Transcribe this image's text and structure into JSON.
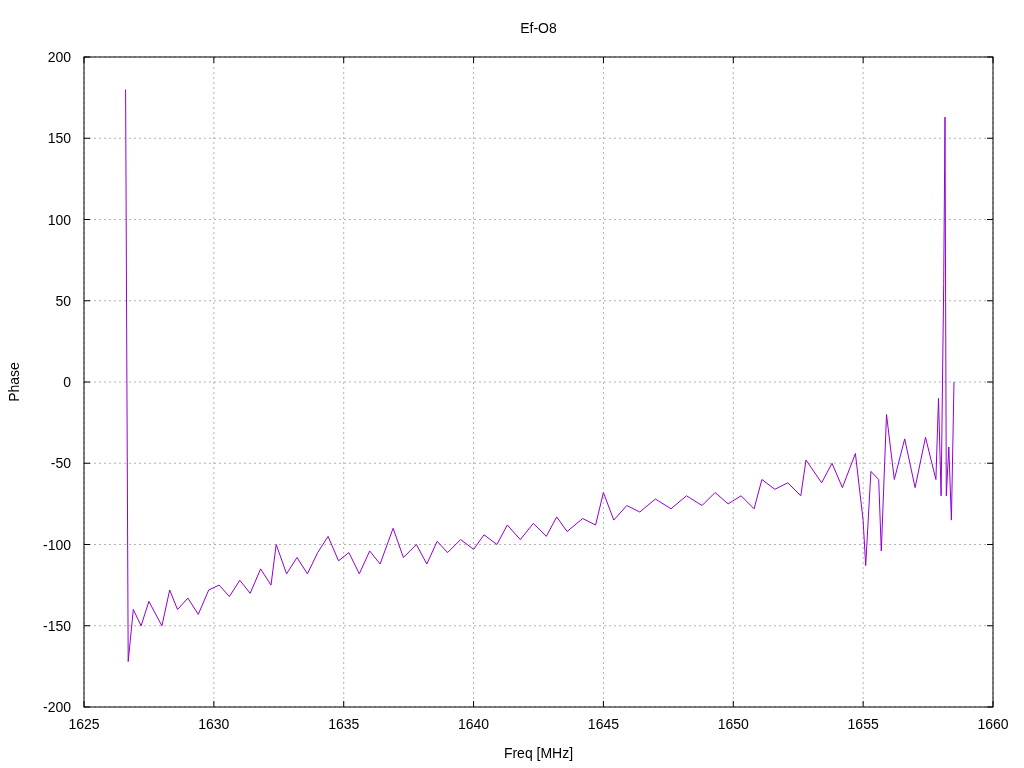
{
  "chart_data": {
    "type": "line",
    "title": "Ef-O8",
    "xlabel": "Freq [MHz]",
    "ylabel": "Phase",
    "xlim": [
      1625,
      1660
    ],
    "ylim": [
      -200,
      200
    ],
    "xticks": [
      1625,
      1630,
      1635,
      1640,
      1645,
      1650,
      1655,
      1660
    ],
    "yticks": [
      -200,
      -150,
      -100,
      -50,
      0,
      50,
      100,
      150,
      200
    ],
    "x": [
      1626.6,
      1626.65,
      1626.7,
      1626.9,
      1627.2,
      1627.5,
      1628.0,
      1628.3,
      1628.6,
      1629.0,
      1629.4,
      1629.8,
      1630.2,
      1630.6,
      1631.0,
      1631.4,
      1631.8,
      1632.2,
      1632.4,
      1632.8,
      1633.2,
      1633.6,
      1634.0,
      1634.4,
      1634.8,
      1635.2,
      1635.6,
      1636.0,
      1636.4,
      1636.9,
      1637.3,
      1637.8,
      1638.2,
      1638.6,
      1639.0,
      1639.5,
      1640.0,
      1640.4,
      1640.9,
      1641.3,
      1641.8,
      1642.3,
      1642.8,
      1643.2,
      1643.6,
      1644.2,
      1644.7,
      1645.0,
      1645.4,
      1645.9,
      1646.4,
      1647.0,
      1647.6,
      1648.2,
      1648.8,
      1649.3,
      1649.8,
      1650.3,
      1650.8,
      1651.1,
      1651.6,
      1652.1,
      1652.6,
      1652.8,
      1653.4,
      1653.8,
      1654.2,
      1654.7,
      1655.0,
      1655.1,
      1655.3,
      1655.6,
      1655.7,
      1655.9,
      1656.2,
      1656.6,
      1657.0,
      1657.4,
      1657.8,
      1657.9,
      1658.0,
      1658.1,
      1658.15,
      1658.2,
      1658.3,
      1658.4,
      1658.5
    ],
    "grid": true,
    "series": [
      {
        "color": "#9400d3",
        "values": [
          180,
          0,
          -172,
          -140,
          -150,
          -135,
          -150,
          -128,
          -140,
          -133,
          -143,
          -128,
          -125,
          -132,
          -122,
          -130,
          -115,
          -125,
          -100,
          -118,
          -108,
          -118,
          -105,
          -95,
          -110,
          -105,
          -118,
          -104,
          -112,
          -90,
          -108,
          -100,
          -112,
          -98,
          -105,
          -97,
          -103,
          -94,
          -100,
          -88,
          -97,
          -87,
          -95,
          -83,
          -92,
          -84,
          -88,
          -68,
          -85,
          -76,
          -80,
          -72,
          -78,
          -70,
          -76,
          -68,
          -75,
          -70,
          -78,
          -60,
          -66,
          -62,
          -70,
          -48,
          -62,
          -50,
          -65,
          -44,
          -85,
          -113,
          -55,
          -60,
          -104,
          -20,
          -60,
          -35,
          -65,
          -34,
          -60,
          -10,
          -70,
          60,
          163,
          -70,
          -40,
          -85,
          0
        ]
      }
    ]
  }
}
